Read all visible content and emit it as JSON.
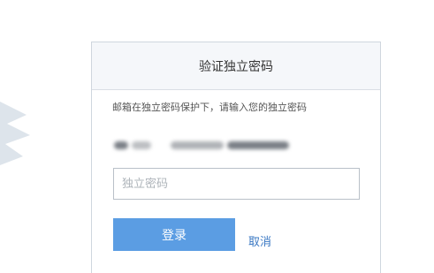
{
  "dialog": {
    "title": "验证独立密码",
    "hint": "邮箱在独立密码保护下，请输入您的独立密码",
    "password_placeholder": "独立密码",
    "password_value": "",
    "login_label": "登录",
    "cancel_label": "取消"
  },
  "colors": {
    "primary_button": "#5b9de3",
    "link": "#3a78c3",
    "header_bg": "#f5f7fa"
  }
}
